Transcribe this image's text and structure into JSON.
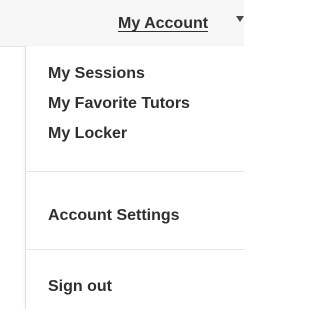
{
  "header": {
    "title": "My Account",
    "dropdown_icon": "caret-down-icon"
  },
  "menu": {
    "items": [
      {
        "label": "My Sessions"
      },
      {
        "label": "My Favorite Tutors"
      },
      {
        "label": "My Locker"
      },
      {
        "label": "Account Settings"
      },
      {
        "label": "Sign out"
      }
    ]
  }
}
